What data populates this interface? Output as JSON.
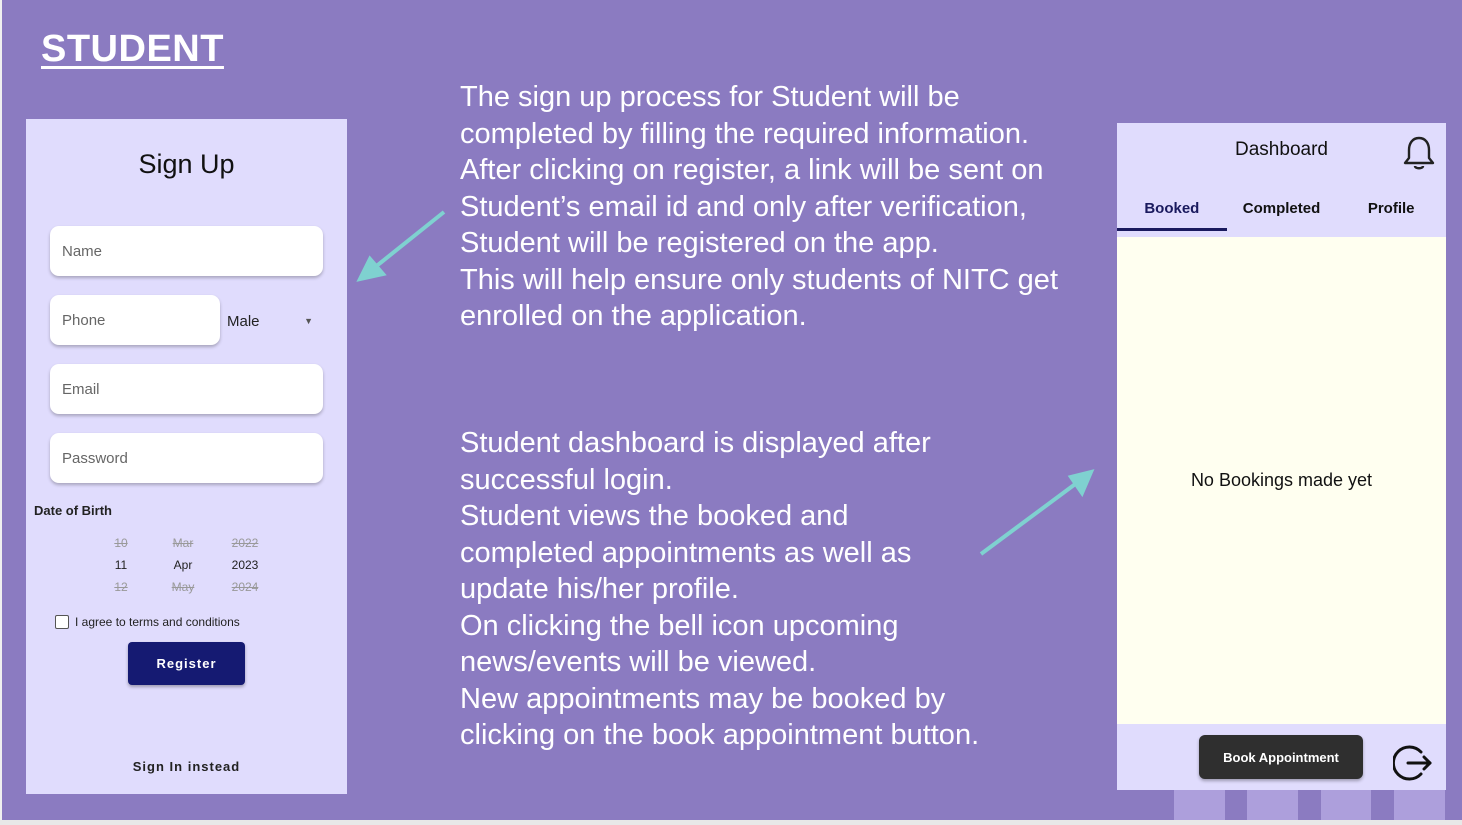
{
  "slide": {
    "title": "STUDENT"
  },
  "signup": {
    "title": "Sign Up",
    "name_placeholder": "Name",
    "phone_placeholder": "Phone",
    "gender_value": "Male",
    "email_placeholder": "Email",
    "password_placeholder": "Password",
    "dob_label": "Date of Birth",
    "dob": {
      "day": {
        "prev": "10",
        "selected": "11",
        "next": "12"
      },
      "month": {
        "prev": "Mar",
        "selected": "Apr",
        "next": "May"
      },
      "year": {
        "prev": "2022",
        "selected": "2023",
        "next": "2024"
      }
    },
    "terms_label": "I agree to terms and conditions",
    "terms_checked": false,
    "register_label": "Register",
    "signin_label": "Sign In instead"
  },
  "description": {
    "signup_paragraphs": [
      "The sign up process for Student will be completed by filling the required information. After clicking on register, a link will be sent on Student’s email id and only after verification, Student will be registered on the app.",
      "This will help ensure only students of NITC get enrolled on the application."
    ],
    "dashboard_paragraphs": [
      "Student dashboard is displayed after successful login.",
      "Student views the booked and completed appointments as well as update his/her profile.",
      "On clicking the bell icon upcoming news/events will be viewed.",
      "New appointments may be booked by clicking on the book appointment button."
    ]
  },
  "dashboard": {
    "title": "Dashboard",
    "tabs": [
      {
        "label": "Booked",
        "active": true
      },
      {
        "label": "Completed",
        "active": false
      },
      {
        "label": "Profile",
        "active": false
      }
    ],
    "empty_message": "No Bookings made yet",
    "book_button_label": "Book Appointment",
    "icons": {
      "bell": "bell-icon",
      "logout": "logout-icon"
    }
  },
  "colors": {
    "background": "#8b7bc1",
    "phone_bg": "#e0dcfd",
    "register_button": "#151a72",
    "arrow": "#7fd1d0",
    "dashboard_body": "#fffff0",
    "book_button": "#2f2f2f"
  }
}
